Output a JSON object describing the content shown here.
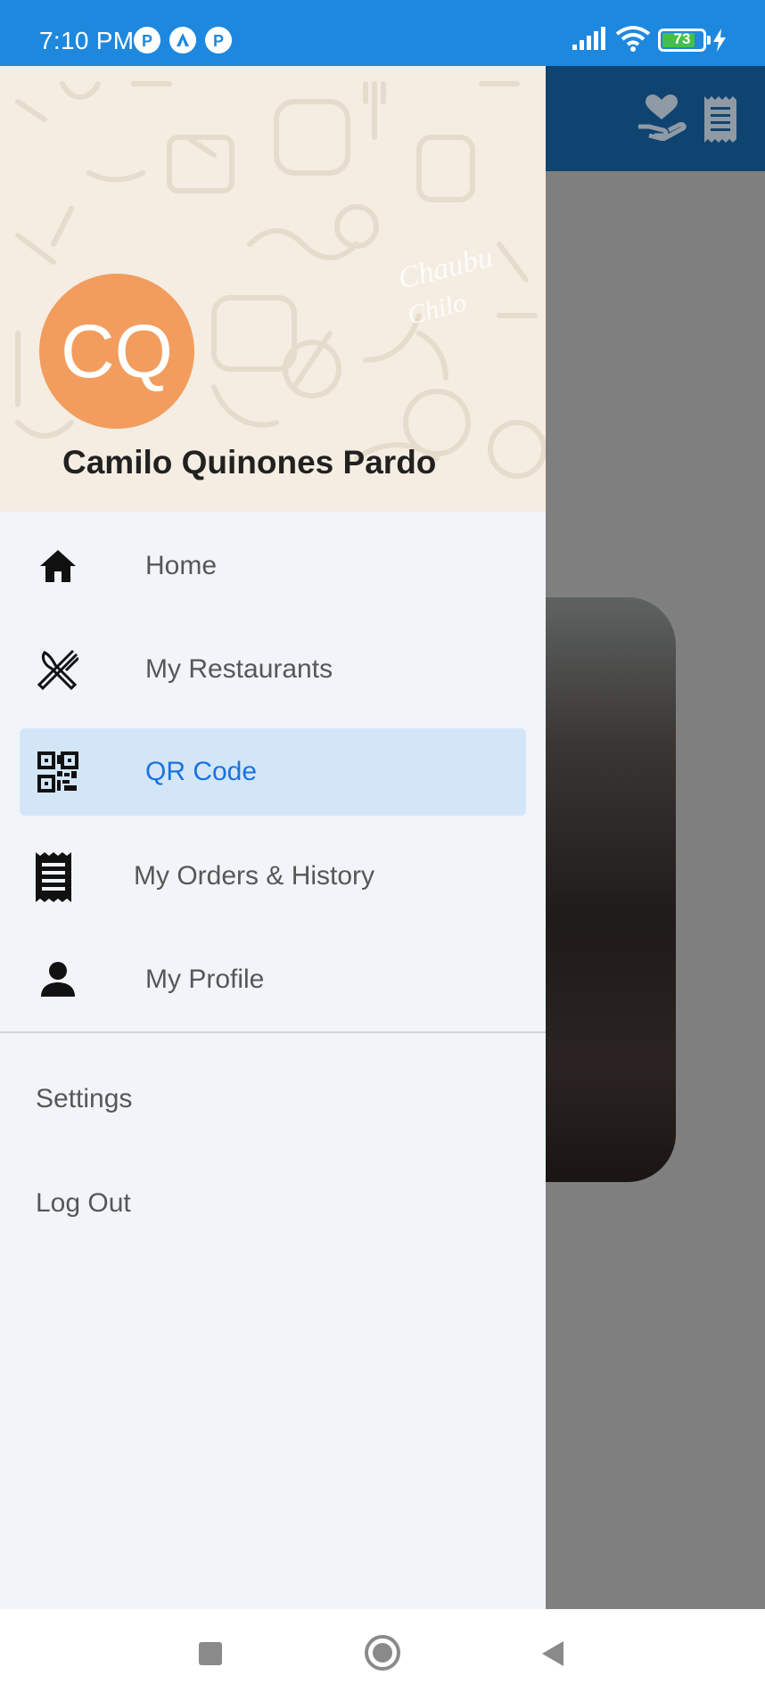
{
  "status_bar": {
    "time": "7:10 PM",
    "battery": "73",
    "notification_icons": [
      "p-icon",
      "a-icon",
      "p-icon"
    ]
  },
  "drawer": {
    "avatar_initials": "CQ",
    "user_name": "Camilo Quinones Pardo",
    "menu": [
      {
        "label": "Home",
        "icon": "home-icon",
        "active": false
      },
      {
        "label": "My Restaurants",
        "icon": "fork-knife-icon",
        "active": false
      },
      {
        "label": "QR Code",
        "icon": "qr-code-icon",
        "active": true
      },
      {
        "label": "My Orders & History",
        "icon": "receipt-icon",
        "active": false
      },
      {
        "label": "My Profile",
        "icon": "person-icon",
        "active": false
      }
    ],
    "settings_label": "Settings",
    "logout_label": "Log Out"
  },
  "colors": {
    "status_bar": "#1e88df",
    "app_header": "#0f4470",
    "avatar": "#f29d5e",
    "active_item_bg": "#d3e6f7",
    "active_item_text": "#1a73e0"
  },
  "header_icons": [
    "heart-hand-icon",
    "receipt-icon"
  ],
  "nav_icons": [
    "recents-square-icon",
    "home-circle-icon",
    "back-triangle-icon"
  ]
}
